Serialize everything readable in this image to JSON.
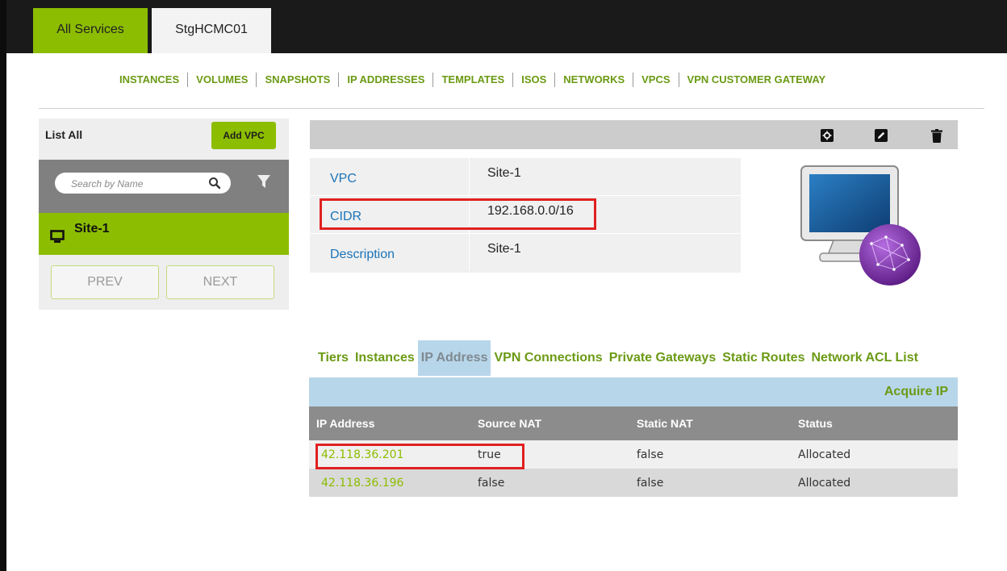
{
  "window": {
    "tabs": [
      "All Services",
      "StgHCMC01"
    ]
  },
  "nav": {
    "items": [
      "INSTANCES",
      "VOLUMES",
      "SNAPSHOTS",
      "IP ADDRESSES",
      "TEMPLATES",
      "ISOS",
      "NETWORKS",
      "VPCS",
      "VPN CUSTOMER GATEWAY"
    ]
  },
  "sidebar": {
    "list_all_label": "List All",
    "add_button": "Add VPC",
    "search_placeholder": "Search by Name",
    "items": [
      {
        "label": "Site-1",
        "icon": "monitor-icon"
      }
    ],
    "prev": "PREV",
    "next": "NEXT"
  },
  "toolbar": {
    "icons": [
      "settings-icon",
      "edit-icon",
      "delete-icon"
    ]
  },
  "details": {
    "rows": [
      {
        "label": "VPC",
        "value": "Site-1"
      },
      {
        "label": "CIDR",
        "value": "192.168.0.0/16"
      },
      {
        "label": "Description",
        "value": "Site-1"
      }
    ]
  },
  "subtabs": {
    "items": [
      "Tiers",
      "Instances",
      "IP Address",
      "VPN Connections",
      "Private Gateways",
      "Static Routes",
      "Network ACL List"
    ],
    "active": "IP Address"
  },
  "ip_table": {
    "action": "Acquire IP",
    "headers": [
      "IP Address",
      "Source NAT",
      "Static NAT",
      "Status"
    ],
    "rows": [
      [
        "42.118.36.201",
        "true",
        "false",
        "Allocated"
      ],
      [
        "42.118.36.196",
        "false",
        "false",
        "Allocated"
      ]
    ]
  },
  "colors": {
    "accent": "#8cbd00",
    "link": "#1a73b8",
    "highlight": "#e02020"
  }
}
